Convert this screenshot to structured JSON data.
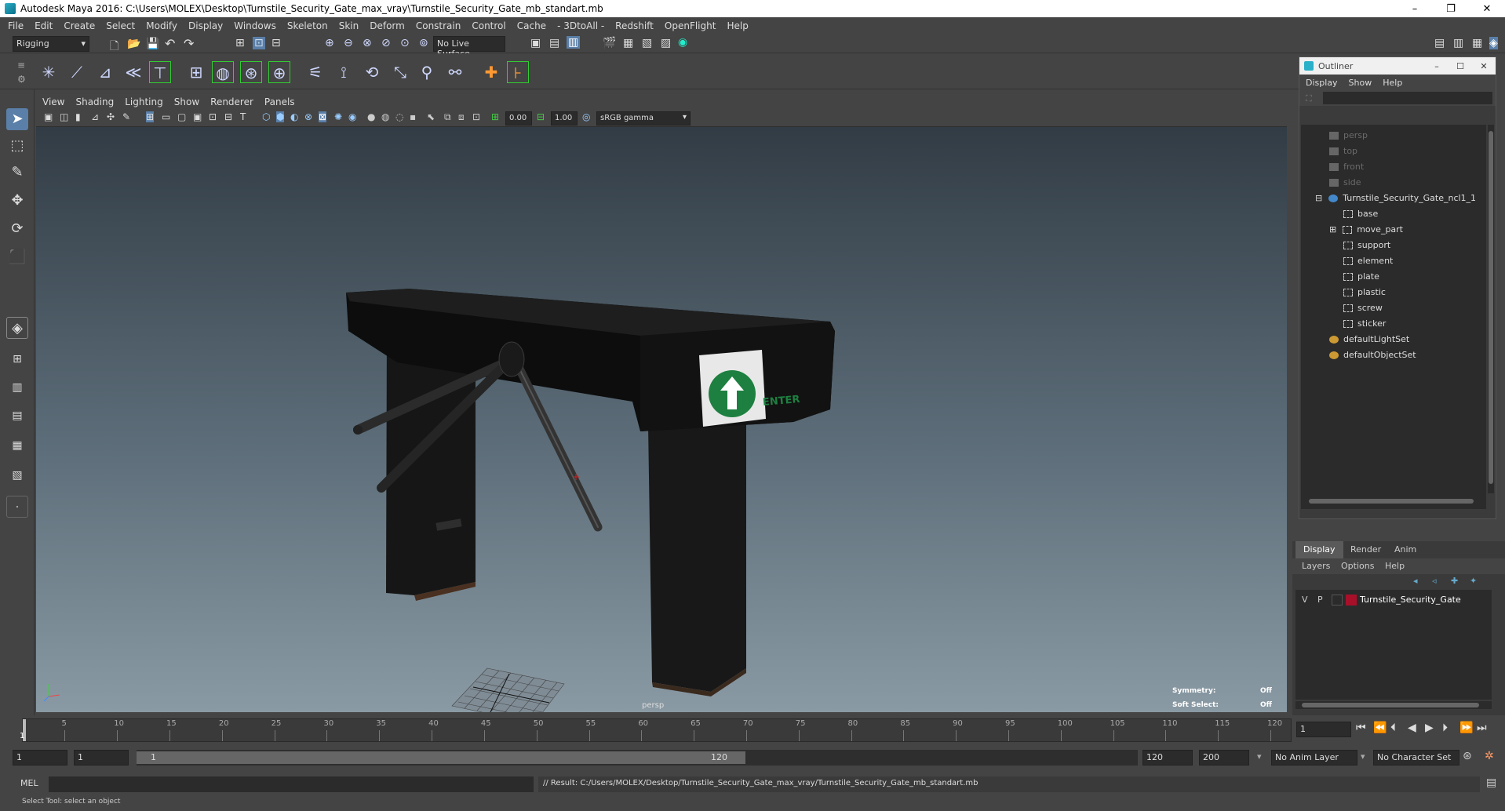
{
  "window": {
    "title": "Autodesk Maya 2016: C:\\Users\\MOLEX\\Desktop\\Turnstile_Security_Gate_max_vray\\Turnstile_Security_Gate_mb_standart.mb",
    "minimize": "–",
    "maximize": "❐",
    "close": "✕"
  },
  "menubar": [
    "File",
    "Edit",
    "Create",
    "Select",
    "Modify",
    "Display",
    "Windows",
    "Skeleton",
    "Skin",
    "Deform",
    "Constrain",
    "Control",
    "Cache",
    "- 3DtoAll -",
    "Redshift",
    "OpenFlight",
    "Help"
  ],
  "statusline": {
    "menuset": "Rigging",
    "live_surface": "No Live Surface"
  },
  "viewport": {
    "menus": [
      "View",
      "Shading",
      "Lighting",
      "Show",
      "Renderer",
      "Panels"
    ],
    "exposure": "0.00",
    "gamma": "1.00",
    "colorspace": "sRGB gamma",
    "camera_label": "persp",
    "sign_text": "ENTER",
    "symmetry_label": "Symmetry:",
    "symmetry_value": "Off",
    "softselect_label": "Soft Select:",
    "softselect_value": "Off"
  },
  "outliner": {
    "title": "Outliner",
    "menus": [
      "Display",
      "Show",
      "Help"
    ],
    "items": [
      {
        "label": "persp",
        "dim": true,
        "indent": 1
      },
      {
        "label": "top",
        "dim": true,
        "indent": 1
      },
      {
        "label": "front",
        "dim": true,
        "indent": 1
      },
      {
        "label": "side",
        "dim": true,
        "indent": 1
      },
      {
        "label": "Turnstile_Security_Gate_ncl1_1",
        "dim": false,
        "indent": 0
      },
      {
        "label": "base",
        "dim": false,
        "indent": 2
      },
      {
        "label": "move_part",
        "dim": false,
        "indent": 2
      },
      {
        "label": "support",
        "dim": false,
        "indent": 2
      },
      {
        "label": "element",
        "dim": false,
        "indent": 2
      },
      {
        "label": "plate",
        "dim": false,
        "indent": 2
      },
      {
        "label": "plastic",
        "dim": false,
        "indent": 2
      },
      {
        "label": "screw",
        "dim": false,
        "indent": 2
      },
      {
        "label": "sticker",
        "dim": false,
        "indent": 2
      },
      {
        "label": "defaultLightSet",
        "dim": false,
        "indent": 1
      },
      {
        "label": "defaultObjectSet",
        "dim": false,
        "indent": 1
      }
    ]
  },
  "layers": {
    "tabs": [
      "Display",
      "Render",
      "Anim"
    ],
    "menus": [
      "Layers",
      "Options",
      "Help"
    ],
    "row": {
      "v": "V",
      "p": "P",
      "name": "Turnstile_Security_Gate",
      "color": "#a8102a"
    }
  },
  "timeslider": {
    "ticks": [
      "5",
      "10",
      "15",
      "20",
      "25",
      "30",
      "35",
      "40",
      "45",
      "50",
      "55",
      "60",
      "65",
      "70",
      "75",
      "80",
      "85",
      "90",
      "95",
      "100",
      "105",
      "110",
      "115",
      "120"
    ],
    "start_tick": "1",
    "current_frame": "1"
  },
  "rangeslider": {
    "start": "1",
    "playback_start": "1",
    "range_start_label": "1",
    "range_end_label": "120",
    "playback_end": "120",
    "end": "200",
    "anim_layer": "No Anim Layer",
    "char_set": "No Character Set"
  },
  "commandline": {
    "lang": "MEL",
    "result": "// Result: C:/Users/MOLEX/Desktop/Turnstile_Security_Gate_max_vray/Turnstile_Security_Gate_mb_standart.mb"
  },
  "helpline": "Select Tool: select an object"
}
